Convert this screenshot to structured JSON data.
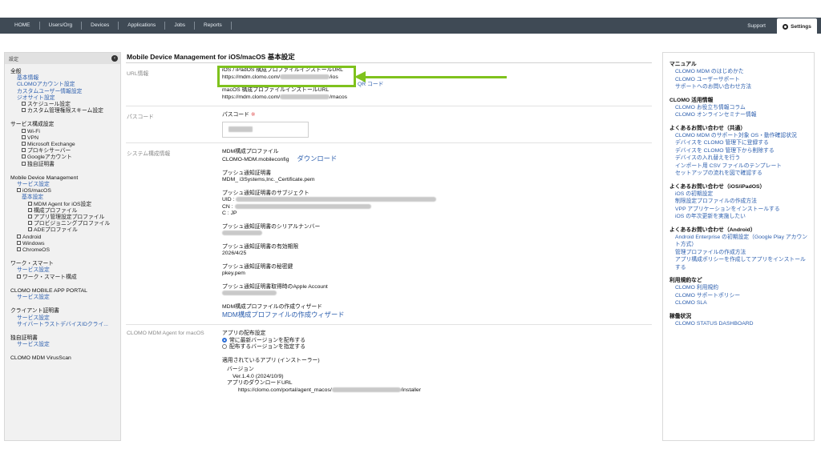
{
  "topbar": {
    "nav": [
      "HOME",
      "Users/Org",
      "Devices",
      "Applications",
      "Jobs",
      "Reports"
    ],
    "support": "Support",
    "settings": "Settings"
  },
  "sidebar": {
    "header": "設定",
    "general": {
      "title": "全般",
      "links": [
        "基本情報",
        "CLOMOアカウント設定",
        "カスタムユーザー情報設定",
        "ジオサイト設定"
      ],
      "subs": [
        "スケジュール設定",
        "カスタム管理権限スキーム設定"
      ]
    },
    "service_config": {
      "title": "サービス構成設定",
      "items": [
        "Wi-Fi",
        "VPN",
        "Microsoft Exchange",
        "プロキシサーバー",
        "Googleアカウント",
        "独自証明書"
      ]
    },
    "mdm": {
      "title": "Mobile Device Management",
      "service_link": "サービス設定",
      "ios_macos": "iOS/macOS",
      "basic": "基本設定",
      "ios_subs": [
        "MDM Agent for iOS設定",
        "構成プロファイル",
        "アプリ管理設定プロファイル",
        "プロビジョニングプロファイル",
        "ADEプロファイル"
      ],
      "others": [
        "Android",
        "Windows",
        "ChromeOS"
      ]
    },
    "work_smart": {
      "title": "ワーク・スマート",
      "service_link": "サービス設定",
      "sub": "ワーク・スマート構成"
    },
    "app_portal": {
      "title": "CLOMO MOBILE APP PORTAL",
      "service_link": "サービス設定"
    },
    "client_cert": {
      "title": "クライアント証明書",
      "links": [
        "サービス設定",
        "サイバートラストデバイスIDクライ..."
      ]
    },
    "own_cert": {
      "title": "独自証明書",
      "service_link": "サービス設定"
    },
    "virus_scan": {
      "title": "CLOMO MDM VirusScan"
    }
  },
  "main": {
    "title": "Mobile Device Management for iOS/macOS 基本設定",
    "url_section": {
      "label": "URL情報",
      "ios_label": "iOS / iPadOS 構成プロファイルインストールURL",
      "qr": "QR コード",
      "ios_url_prefix": "https://mdm.clomo.com/",
      "ios_url_suffix": "/ios",
      "mac_label": "macOS 構成プロファイルインストールURL",
      "mac_url_prefix": "https://mdm.clomo.com/",
      "mac_url_suffix": "/macos"
    },
    "passcode_section": {
      "label": "パスコード",
      "field_label": "パスコード",
      "required_mark": "※"
    },
    "system_section": {
      "label": "システム構成情報",
      "profile_label": "MDM構成プロファイル",
      "profile_file": "CLOMO-MDM.mobileconfig",
      "download": "ダウンロード",
      "push_cert_label": "プッシュ通知証明書",
      "push_cert_value": "MDM_ i3Systems,Inc._Certificate.pem",
      "subject_label": "プッシュ通知証明書のサブジェクト",
      "uid": "UID  :",
      "cn": "CN  :",
      "c": "C    :  JP",
      "serial_label": "プッシュ通知証明書のシリアルナンバー",
      "expiry_label": "プッシュ通知証明書の有効期限",
      "expiry_value": "2026/4/25",
      "key_label": "プッシュ通知証明書の秘密鍵",
      "key_value": "pkey.pem",
      "apple_label": "プッシュ通知証明書取得時のApple Account",
      "wizard_label": "MDM構成プロファイルの作成ウィザード",
      "wizard_link": "MDM構成プロファイルの作成ウィザード"
    },
    "agent_section": {
      "label": "CLOMO MDM Agent for macOS",
      "dist_label": "アプリの配布設定",
      "opt_latest": "常に最新バージョンを配布する",
      "opt_specify": "配布するバージョンを指定する",
      "applied_label": "適用されているアプリ (インストーラー)",
      "version_label": "バージョン",
      "version_value": "Ver.1.4.0 (2024/10/9)",
      "download_url_label": "アプリのダウンロードURL",
      "url_prefix": "https://clomo.com/portal/agent_macos/",
      "url_suffix": "/installer"
    }
  },
  "rightpanel": {
    "sections": [
      {
        "title": "マニュアル",
        "links": [
          "CLOMO MDM のはじめかた",
          "CLOMO ユーザーサポート",
          "サポートへのお問い合わせ方法"
        ]
      },
      {
        "title": "CLOMO 活用情報",
        "links": [
          "CLOMO お役立ち情報コラム",
          "CLOMO オンラインセミナー情報"
        ]
      },
      {
        "title": "よくあるお問い合わせ（共通）",
        "links": [
          "CLOMO MDM のサポート対象 OS・動作確認状況",
          "デバイスを CLOMO 管理下に登録する",
          "デバイスを CLOMO 管理下から削除する",
          "デバイスの入れ替えを行う",
          "インポート用 CSV ファイルのテンプレート",
          "セットアップの流れを図で確認する"
        ]
      },
      {
        "title": "よくあるお問い合わせ（iOS/iPadOS）",
        "links": [
          "iOS の初期設定",
          "制限設定プロファイルの作成方法",
          "VPP アプリケーションをインストールする",
          "iOS の年次更新を実施したい"
        ]
      },
      {
        "title": "よくあるお問い合わせ（Android）",
        "links": [
          "Android Enterprise の初期設定（Google Play アカウント方式）",
          "管理プロファイルの作成方法",
          "アプリ構成ポリシーを作成してアプリをインストールする"
        ]
      },
      {
        "title": "利用規約など",
        "links": [
          "CLOMO 利用規約",
          "CLOMO サポートポリシー",
          "CLOMO SLA"
        ]
      },
      {
        "title": "稼働状況",
        "links": [
          "CLOMO STATUS DASHBOARD"
        ]
      }
    ]
  },
  "colors": {
    "topbar": "#3f4a55",
    "link": "#2d5fae",
    "highlight": "#7fc21d"
  }
}
